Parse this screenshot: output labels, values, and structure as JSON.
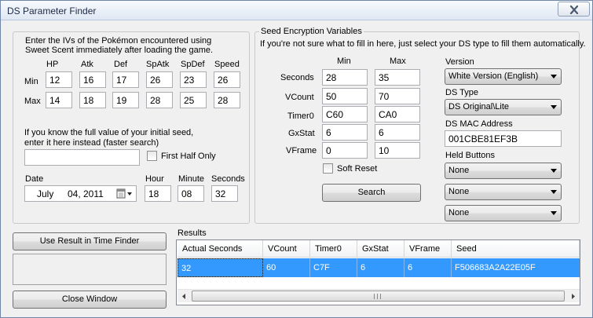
{
  "window": {
    "title": "DS Parameter Finder"
  },
  "ivs": {
    "instruction_line1": "Enter the IVs of the Pokémon encountered using",
    "instruction_line2": "Sweet Scent immediately after loading the game.",
    "stats": [
      "HP",
      "Atk",
      "Def",
      "SpAtk",
      "SpDef",
      "Speed"
    ],
    "min_label": "Min",
    "max_label": "Max",
    "min": [
      "12",
      "16",
      "17",
      "26",
      "23",
      "26"
    ],
    "max": [
      "14",
      "18",
      "19",
      "28",
      "25",
      "28"
    ]
  },
  "seed": {
    "line1": "If you know the full value of your initial seed,",
    "line2": "enter it here instead (faster search)",
    "value": "",
    "first_half_label": "First Half Only"
  },
  "datetime": {
    "date_label": "Date",
    "hour_label": "Hour",
    "minute_label": "Minute",
    "seconds_label": "Seconds",
    "date_month": "July",
    "date_day": "04,",
    "date_year": "2011",
    "hour": "18",
    "minute": "08",
    "seconds": "32"
  },
  "encryption": {
    "title": "Seed Encryption Variables",
    "hint": "If you're not sure what to fill in here, just select your DS type to fill them automatically.",
    "min_header": "Min",
    "max_header": "Max",
    "rows": [
      {
        "label": "Seconds",
        "min": "28",
        "max": "35"
      },
      {
        "label": "VCount",
        "min": "50",
        "max": "70"
      },
      {
        "label": "Timer0",
        "min": "C60",
        "max": "CA0"
      },
      {
        "label": "GxStat",
        "min": "6",
        "max": "6"
      },
      {
        "label": "VFrame",
        "min": "0",
        "max": "10"
      }
    ],
    "soft_reset_label": "Soft Reset",
    "search_label": "Search",
    "version_label": "Version",
    "version_value": "White Version (English)",
    "ds_type_label": "DS Type",
    "ds_type_value": "DS Original\\Lite",
    "mac_label": "DS MAC Address",
    "mac_value": "001CBE81EF3B",
    "held_label": "Held Buttons",
    "held_values": [
      "None",
      "None",
      "None"
    ]
  },
  "actions": {
    "use_result_label": "Use Result in Time Finder",
    "close_label": "Close Window"
  },
  "results": {
    "title": "Results",
    "columns": [
      "Actual Seconds",
      "VCount",
      "Timer0",
      "GxStat",
      "VFrame",
      "Seed"
    ],
    "rows": [
      [
        "32",
        "60",
        "C7F",
        "6",
        "6",
        "F506683A2A22E05F"
      ]
    ]
  },
  "colors": {
    "selection": "#3399ff",
    "title_text": "#1b2a44"
  },
  "icons": {
    "close": "close-x-icon",
    "calendar": "calendar-icon"
  }
}
